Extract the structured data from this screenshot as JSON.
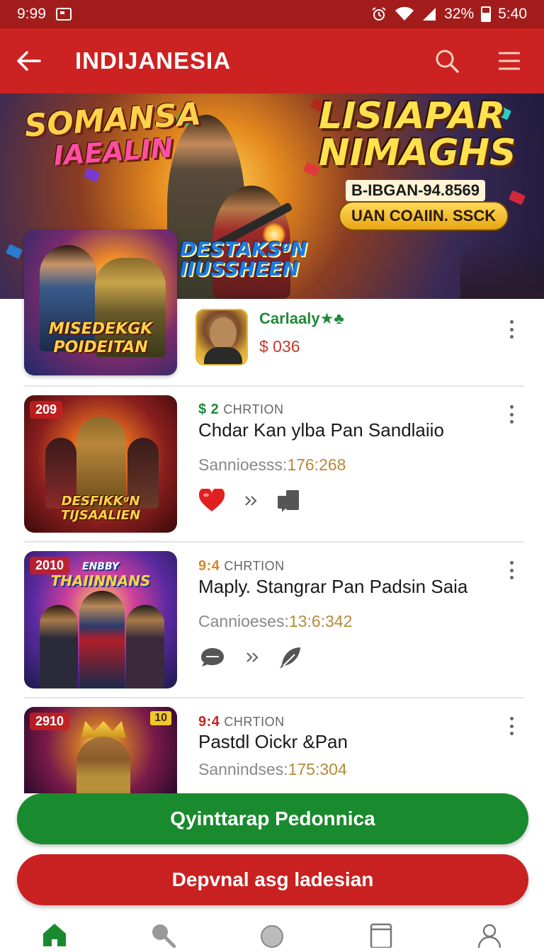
{
  "status_bar": {
    "time": "9:99",
    "battery": "32%",
    "clock": "5:40"
  },
  "app_bar": {
    "title": "INDIJANESIA"
  },
  "banner": {
    "left_title_line1": "SOMANSA",
    "left_title_line2": "IAEALIN",
    "right_title_line1": "LISIAPAR",
    "right_title_line2": "NIMAGHS",
    "code": "B-IBGAN-94.8569",
    "pill": "UAN COAIIN. SSCK",
    "center_caption_line1": "DESTAKSᵍN",
    "center_caption_line2": "IIUSSHEEN"
  },
  "featured": {
    "tile_caption_line1": "MISEDEKGK",
    "tile_caption_line2": "POIDEITAN",
    "name": "Carlaaly★♣",
    "price": "$ 036"
  },
  "items": [
    {
      "badge": "209",
      "meta_num": "$ 2",
      "meta_label": "CHRTION",
      "meta_color": "#1f8a3a",
      "title": "Chdar Kan ylba Pan Sandlaiio",
      "sub_label": "Sannioesss:",
      "sub_value": "176:268",
      "thumb_caption_line1": "DESFIKKᵍN",
      "thumb_caption_line2": "TIJSAALIEN",
      "actions": [
        "heart-icon",
        "double-chevron-icon",
        "share-box-icon"
      ]
    },
    {
      "badge": "2010",
      "meta_num": "9:4",
      "meta_label": "CHRTION",
      "meta_color": "#d4892a",
      "title": "Maplу. Stangrar Pan Padsin Saia",
      "sub_label": "Cannioeses:",
      "sub_value": "13:6:342",
      "thumb_caption_line1": "ENBBY",
      "thumb_caption_line2": "THAIINNANS",
      "actions": [
        "chat-bubble-icon",
        "double-chevron-icon",
        "feather-icon"
      ]
    },
    {
      "badge": "2910",
      "meta_num": "9:4",
      "meta_label": "CHRTION",
      "meta_color": "#c92121",
      "title": "Pastdl Oickr &Pan",
      "sub_label": "Sannindses:",
      "sub_value": "175:304",
      "thumb_caption_line1": "",
      "thumb_caption_line2": "",
      "corner_tag": "10",
      "actions": []
    }
  ],
  "buttons": {
    "primary": "Qyinttarap Pedonnica",
    "secondary": "Depvnal asg ladesian"
  },
  "colors": {
    "brand_red": "#cc2222",
    "status_red": "#a31c1c",
    "brand_green": "#1a8a2e"
  },
  "bottom_nav": [
    "home-icon",
    "search-icon",
    "circle-icon",
    "tablet-icon",
    "profile-icon"
  ]
}
